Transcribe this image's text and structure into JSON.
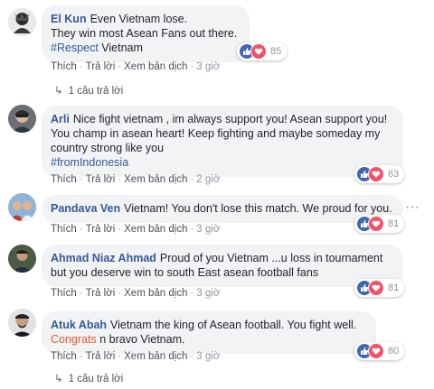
{
  "comments": [
    {
      "name": "El Kun",
      "lines": [
        "Even Vietnam lose.",
        "They win most Asean Fans out there."
      ],
      "tag": "#Respect",
      "tag_suffix": " Vietnam",
      "actions": {
        "like": "Thích",
        "reply": "Trả lời",
        "translate": "Xem bản dịch",
        "time": "3 giờ"
      },
      "reactions": "85",
      "replies": "1 câu trả lời"
    },
    {
      "name": "Arli",
      "lines": [
        "Nice fight vietnam , im always support you! Asean support you!",
        "You champ in asean heart! Keep fighting and maybe someday my",
        "country strong like you"
      ],
      "tag": "#fromIndonesia",
      "actions": {
        "like": "Thích",
        "reply": "Trả lời",
        "translate": "Xem bản dịch",
        "time": "2 giờ"
      },
      "reactions": "63"
    },
    {
      "name": "Pandava Ven",
      "lines": [
        "Vietnam! You don't lose this match. We proud for you."
      ],
      "actions": {
        "like": "Thích",
        "reply": "Trả lời",
        "translate": "Xem bản dịch",
        "time": "3 giờ"
      },
      "reactions": "81",
      "more": "···"
    },
    {
      "name": "Ahmad Niaz Ahmad",
      "lines": [
        "Proud of you Vietnam ...u loss in tournament",
        "but you deserve win to south East asean football fans"
      ],
      "actions": {
        "like": "Thích",
        "reply": "Trả lời",
        "translate": "Xem bản dịch",
        "time": "3 giờ"
      },
      "reactions": "81"
    },
    {
      "name": "Atuk Abah",
      "lines": [
        "Vietnam the king of Asean football. You fight well."
      ],
      "highlight": "Congrats",
      "highlight_suffix": " n bravo Vietnam.",
      "actions": {
        "like": "Thích",
        "reply": "Trả lời",
        "translate": "Xem bản dịch",
        "time": "3 giờ"
      },
      "reactions": "80",
      "replies": "1 câu trả lời"
    }
  ],
  "colors": {
    "name": "#365899",
    "bubble": "#f2f3f5",
    "like": "#4267b2",
    "love": "#f25268",
    "congrats": "#e4572e"
  },
  "icons": {
    "like": "thumbs-up-icon",
    "love": "heart-icon",
    "reply_arrow": "reply-arrow-icon"
  }
}
